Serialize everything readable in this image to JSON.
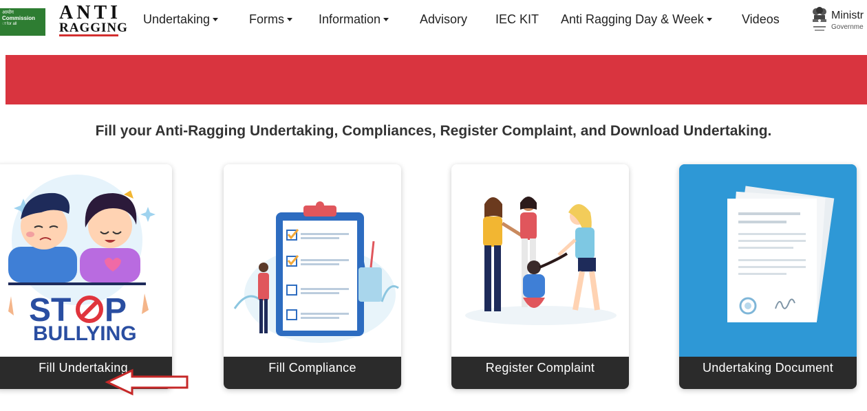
{
  "header": {
    "ugc_logo": {
      "line1": "आयोग",
      "line2": "Commission",
      "line3": "ा for all"
    },
    "site_logo": {
      "line1": "ANTI",
      "line2": "RAGGING"
    },
    "nav": [
      {
        "label": "Undertaking",
        "dropdown": true
      },
      {
        "label": "Forms",
        "dropdown": true
      },
      {
        "label": "Information",
        "dropdown": true
      },
      {
        "label": "Advisory",
        "dropdown": false
      },
      {
        "label": "IEC KIT",
        "dropdown": false
      },
      {
        "label": "Anti Ragging Day & Week",
        "dropdown": true
      },
      {
        "label": "Videos",
        "dropdown": false
      }
    ],
    "ministry": {
      "line1": "Ministr",
      "line2": "Governme"
    }
  },
  "tagline": "Fill your Anti-Ragging Undertaking, Compliances, Register Complaint, and Download Undertaking.",
  "cards": [
    {
      "label": "Fill Undertaking",
      "illustration": "stop-bullying",
      "art_words": [
        "ST",
        "P",
        "BULLYING"
      ]
    },
    {
      "label": "Fill Compliance",
      "illustration": "checklist-clipboard"
    },
    {
      "label": "Register Complaint",
      "illustration": "bullying-group"
    },
    {
      "label": "Undertaking Document",
      "illustration": "document-stack"
    }
  ],
  "colors": {
    "banner": "#d9343f",
    "card_label_bar": "#2b2b2b",
    "document_card_bg": "#2e98d6",
    "ugc_green": "#2e7d32",
    "annotation_arrow": "#c62828"
  },
  "annotation": {
    "type": "arrow",
    "points_to": "Fill Undertaking"
  }
}
